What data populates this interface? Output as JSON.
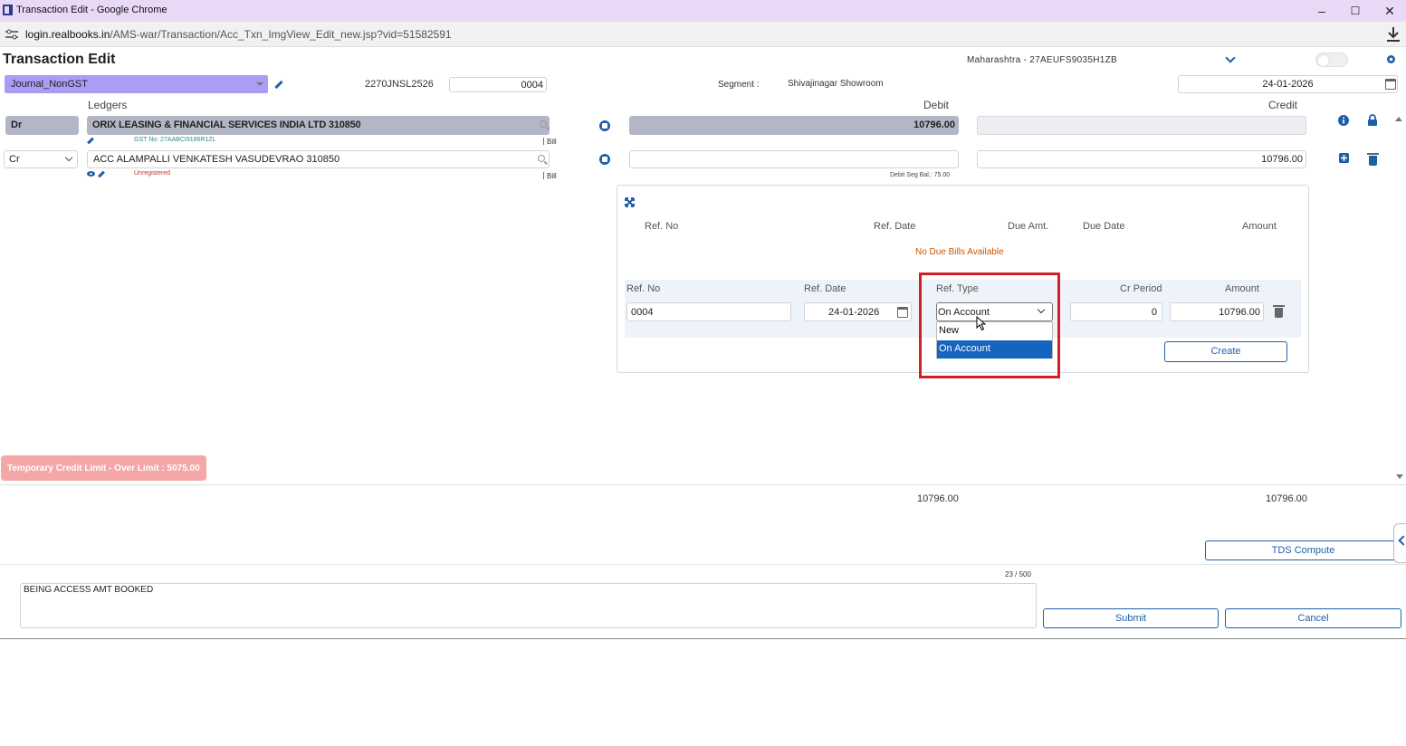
{
  "window": {
    "title": "Transaction Edit - Google Chrome",
    "url_host": "login.realbooks.in",
    "url_path": "/AMS-war/Transaction/Acc_Txn_ImgView_Edit_new.jsp?vid=51582591"
  },
  "header": {
    "page_title": "Transaction Edit",
    "state_gst": "Maharashtra - 27AEUFS9035H1ZB"
  },
  "voucher": {
    "type": "Journal_NonGST",
    "number_prefix": "2270JNSL2526",
    "number": "0004",
    "segment_label": "Segment :",
    "segment_value": "Shivajinagar Showroom",
    "date": "24-01-2026"
  },
  "columns": {
    "ledgers": "Ledgers",
    "debit": "Debit",
    "credit": "Credit"
  },
  "entries": [
    {
      "side": "Dr",
      "ledger": "ORIX LEASING & FINANCIAL SERVICES INDIA LTD 310850",
      "sub": "GST No: 27AABCI9186R1ZL",
      "bill": "Bill",
      "debit": "10796.00",
      "credit": ""
    },
    {
      "side": "Cr",
      "ledger": "ACC ALAMPALLI VENKATESH VASUDEVRAO 310850",
      "sub": "Unregistered",
      "bill": "Bill",
      "debit": "",
      "credit": "10796.00",
      "seg_balance": "Debit Seg Bal.: 75.00"
    }
  ],
  "bills": {
    "headers": {
      "ref_no": "Ref. No",
      "ref_date": "Ref. Date",
      "due_amt": "Due Amt.",
      "due_date": "Due Date",
      "amount": "Amount"
    },
    "empty_message": "No Due Bills Available",
    "new_bill": {
      "labels": {
        "ref_no": "Ref. No",
        "ref_date": "Ref. Date",
        "ref_type": "Ref. Type",
        "cr_period": "Cr Period",
        "amount": "Amount"
      },
      "ref_no": "0004",
      "ref_date": "24-01-2026",
      "ref_type": "On Account",
      "ref_type_options": [
        "New",
        "On Account"
      ],
      "cr_period": "0",
      "amount": "10796.00"
    },
    "create_label": "Create"
  },
  "warning": "Temporary Credit Limit - Over Limit : 5075.00",
  "totals": {
    "debit": "10796.00",
    "credit": "10796.00"
  },
  "tds_label": "TDS Compute",
  "narration": {
    "text": "BEING ACCESS AMT BOOKED",
    "count": "23 / 500"
  },
  "actions": {
    "submit": "Submit",
    "cancel": "Cancel"
  },
  "colors": {
    "accent": "#1f5fa8",
    "journal_bg": "#ab9df6",
    "highlight": "#d21f26",
    "warning_bg": "#f5a6a6"
  }
}
